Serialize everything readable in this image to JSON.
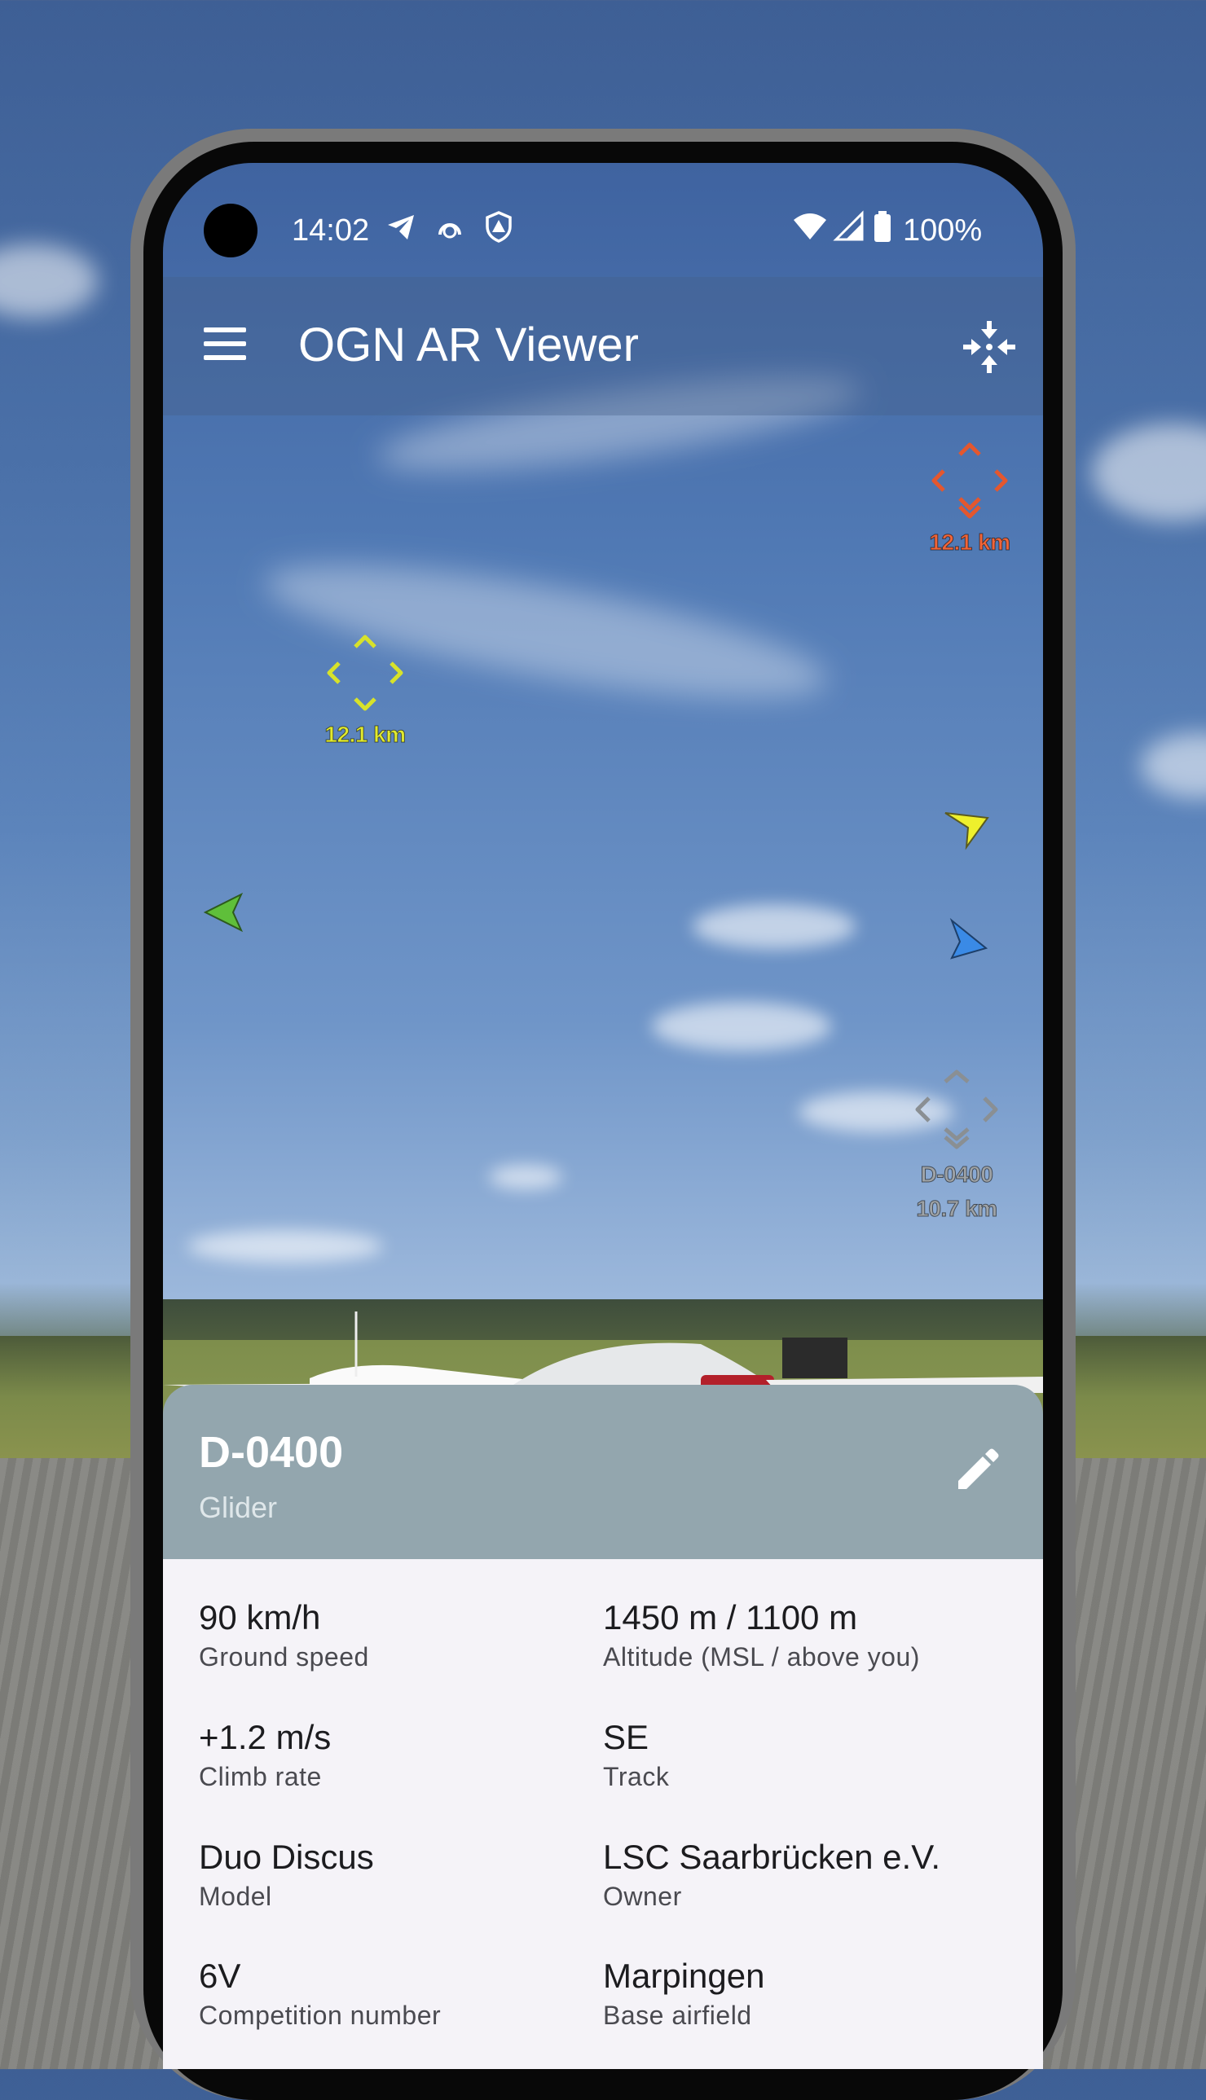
{
  "status_bar": {
    "time": "14:02",
    "battery_percent": "100%",
    "icons": [
      "telegram-icon",
      "vpn-icon",
      "shield-alert-icon",
      "wifi-icon",
      "signal-icon",
      "battery-icon"
    ]
  },
  "app_bar": {
    "title": "OGN AR Viewer",
    "menu_icon": "menu-icon",
    "action_icon": "center-focus-icon"
  },
  "ar_markers": [
    {
      "id": "red",
      "distance": "12.1 km",
      "color": "#e4572e"
    },
    {
      "id": "yellow",
      "distance": "12.1 km",
      "color": "#d7e22a"
    },
    {
      "id": "grey",
      "callsign": "D-0400",
      "distance": "10.7 km",
      "color": "#8a8f93"
    }
  ],
  "edge_arrows": [
    {
      "id": "yellow-arrow",
      "color": "#eef02c"
    },
    {
      "id": "green-arrow",
      "color": "#5fbf3a"
    },
    {
      "id": "blue-arrow",
      "color": "#3a8ae6"
    }
  ],
  "detail_sheet": {
    "callsign": "D-0400",
    "aircraft_type": "Glider",
    "edit_icon": "edit-icon",
    "fields": [
      {
        "value": "90 km/h",
        "label": "Ground speed"
      },
      {
        "value": "1450 m / 1100 m",
        "label": "Altitude (MSL / above you)"
      },
      {
        "value": "+1.2 m/s",
        "label": "Climb rate"
      },
      {
        "value": "SE",
        "label": "Track"
      },
      {
        "value": "Duo Discus",
        "label": "Model"
      },
      {
        "value": "LSC Saarbrücken e.V.",
        "label": "Owner"
      },
      {
        "value": "6V",
        "label": "Competition number"
      },
      {
        "value": "Marpingen",
        "label": "Base airfield"
      }
    ]
  }
}
